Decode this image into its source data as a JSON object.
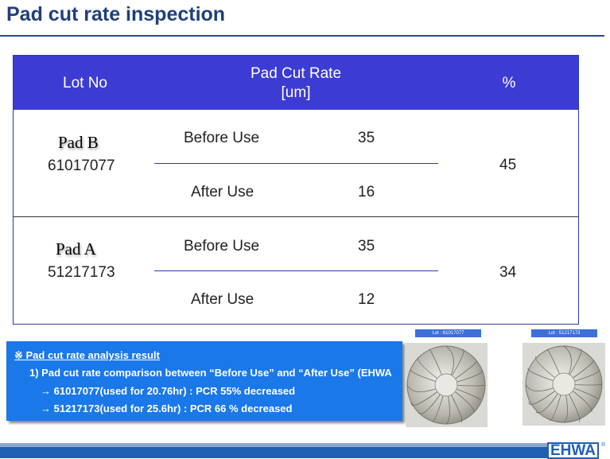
{
  "title": "Pad cut rate inspection",
  "table": {
    "header": {
      "lot_no": "Lot No",
      "pcr_line1": "Pad Cut Rate",
      "pcr_line2": "[um]",
      "percent": "%"
    },
    "rows": [
      {
        "pad": "Pad B",
        "lot": "61017077",
        "before_label": "Before Use",
        "before_value": "35",
        "after_label": "After Use",
        "after_value": "16",
        "percent": "45"
      },
      {
        "pad": "Pad A",
        "lot": "51217173",
        "before_label": "Before Use",
        "before_value": "35",
        "after_label": "After Use",
        "after_value": "12",
        "percent": "34"
      }
    ]
  },
  "result": {
    "heading": "※ Pad cut rate analysis result",
    "line1": "1) Pad cut rate comparison between “Before Use” and “After Use” (EHWA",
    "line2": "→ 61017077(used for 20.76hr) : PCR 55% decreased",
    "line3": "→ 51217173(used for 25.6hr) : PCR 66 % decreased"
  },
  "photos": [
    {
      "tag": "Lot : 61017077"
    },
    {
      "tag": "Lot : 51217173"
    }
  ],
  "logo": {
    "text": "EHWA",
    "mark": "®"
  },
  "colors": {
    "header_blue": "#3c3cd4",
    "title_navy": "#1f3f7a",
    "result_blue": "#1a78e8"
  }
}
